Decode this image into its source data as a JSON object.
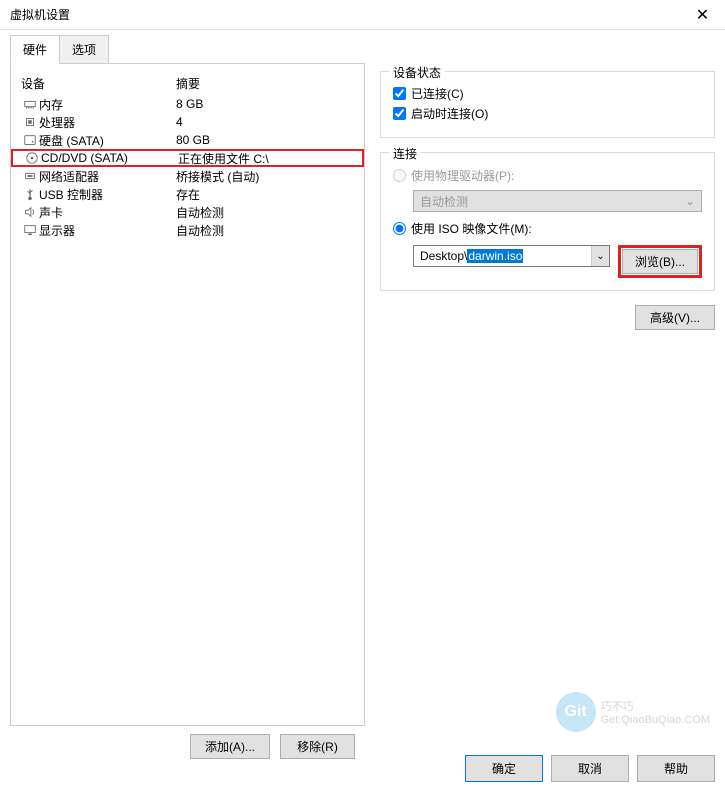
{
  "window": {
    "title": "虚拟机设置"
  },
  "tabs": {
    "hardware": "硬件",
    "options": "选项"
  },
  "list": {
    "header_device": "设备",
    "header_summary": "摘要",
    "items": [
      {
        "name": "内存",
        "summary": "8 GB",
        "icon": "memory"
      },
      {
        "name": "处理器",
        "summary": "4",
        "icon": "cpu"
      },
      {
        "name": "硬盘 (SATA)",
        "summary": "80 GB",
        "icon": "disk"
      },
      {
        "name": "CD/DVD (SATA)",
        "summary": "正在使用文件 C:\\",
        "icon": "cd",
        "highlight": true
      },
      {
        "name": "网络适配器",
        "summary": "桥接模式 (自动)",
        "icon": "network"
      },
      {
        "name": "USB 控制器",
        "summary": "存在",
        "icon": "usb"
      },
      {
        "name": "声卡",
        "summary": "自动检测",
        "icon": "sound"
      },
      {
        "name": "显示器",
        "summary": "自动检测",
        "icon": "display"
      }
    ]
  },
  "buttons": {
    "add": "添加(A)...",
    "remove": "移除(R)"
  },
  "device_status": {
    "title": "设备状态",
    "connected": "已连接(C)",
    "connect_at_power_on": "启动时连接(O)"
  },
  "connection": {
    "title": "连接",
    "physical": "使用物理驱动器(P):",
    "auto_detect": "自动检测",
    "iso": "使用 ISO 映像文件(M):",
    "iso_path_prefix": "Desktop\\",
    "iso_path_sel": "darwin.iso",
    "browse": "浏览(B)..."
  },
  "advanced": "高级(V)...",
  "footer": {
    "ok": "确定",
    "cancel": "取消",
    "help": "帮助"
  },
  "watermark": {
    "badge": "Git",
    "line1": "巧不巧",
    "line2": "Get.QiaoBuQiao.COM"
  }
}
